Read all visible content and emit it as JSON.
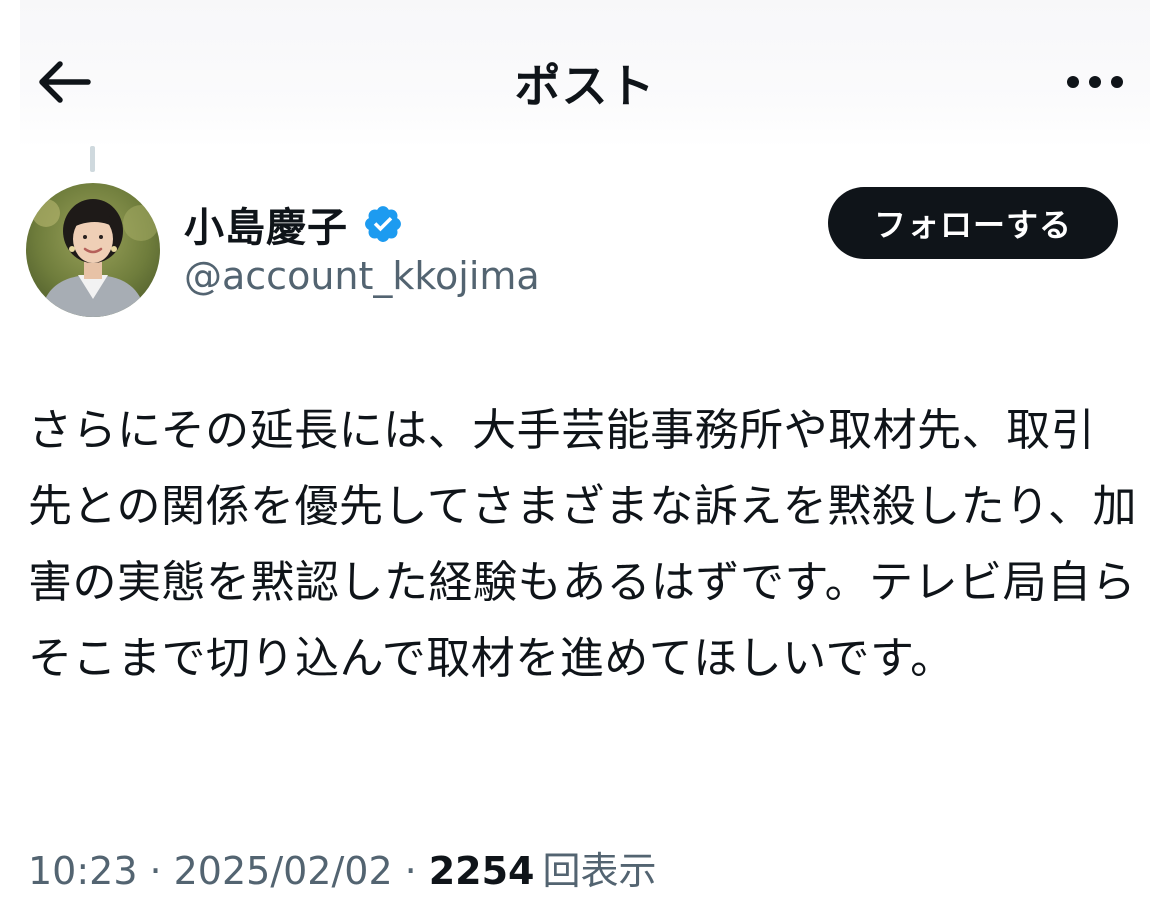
{
  "header": {
    "title": "ポスト",
    "back_icon": "arrow-left-icon",
    "more_icon": "more-horizontal-icon"
  },
  "author": {
    "display_name": "小島慶子",
    "handle": "@account_kkojima",
    "verified_icon": "verified-badge-icon",
    "verified_color": "#1d9bf0"
  },
  "follow_button": {
    "label": "フォローする"
  },
  "post": {
    "text": "さらにその延長には、大手芸能事務所や取材先、取引先との関係を優先してさまざまな訴えを黙殺したり、加害の実態を黙認した経験もあるはずです。テレビ局自らそこまで切り込んで取材を進めてほしいです。"
  },
  "meta": {
    "time": "10:23",
    "separator": "·",
    "date": "2025/02/02",
    "views_count": "2254",
    "views_label": "回表示"
  }
}
